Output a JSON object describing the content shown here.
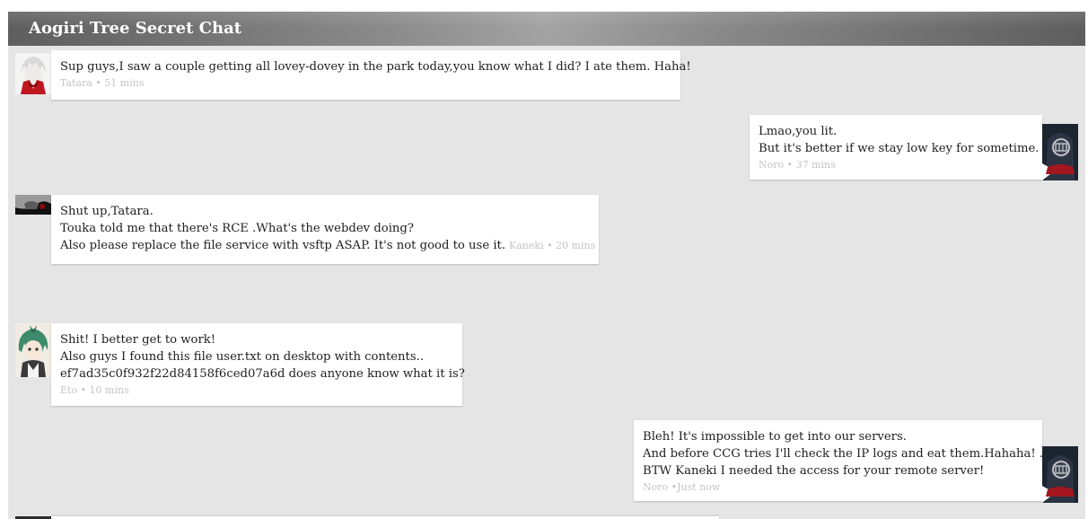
{
  "app": {
    "title": "Aogiri Tree Secret Chat"
  },
  "messages": [
    {
      "author": "Tatara",
      "side": "left",
      "avatar_icon": "tatara-avatar-icon",
      "lines": [
        "Sup guys,I saw a couple getting all lovey-dovey in the park today,you know what I did? I ate them. Haha!"
      ],
      "meta": "Tatara • 51 mins"
    },
    {
      "author": "Noro",
      "side": "right",
      "avatar_icon": "noro-avatar-icon",
      "lines": [
        "Lmao,you lit.",
        "But it's better if we stay low key for sometime."
      ],
      "meta": "Noro • 37 mins"
    },
    {
      "author": "Kaneki",
      "side": "left",
      "avatar_icon": "kaneki-avatar-icon",
      "lines": [
        "Shut up,Tatara.",
        "Touka told me that there's RCE .What's the webdev doing?",
        "Also please replace the file service with vsftp ASAP. It's not good to use it."
      ],
      "meta": "Kaneki • 20 mins"
    },
    {
      "author": "Eto",
      "side": "left",
      "avatar_icon": "eto-avatar-icon",
      "lines": [
        "Shit! I better get to work!",
        "Also guys I found this file user.txt on desktop with contents..",
        "ef7ad35c0f932f22d84158f6ced07a6d does anyone know what it is?"
      ],
      "meta": "Eto • 10 mins"
    },
    {
      "author": "Noro",
      "side": "right",
      "avatar_icon": "noro-avatar-icon",
      "lines": [
        "Bleh! It's impossible to get into our servers.",
        "And before CCG tries I'll check the IP logs and eat them.Hahaha! .",
        "BTW Kaneki I needed the access for your remote server!"
      ],
      "meta": "Noro •Just now"
    }
  ],
  "colors": {
    "background": "#e5e5e5",
    "bubble": "#ffffff",
    "meta_text": "#c4c4c4",
    "title_text": "#ffffff"
  }
}
